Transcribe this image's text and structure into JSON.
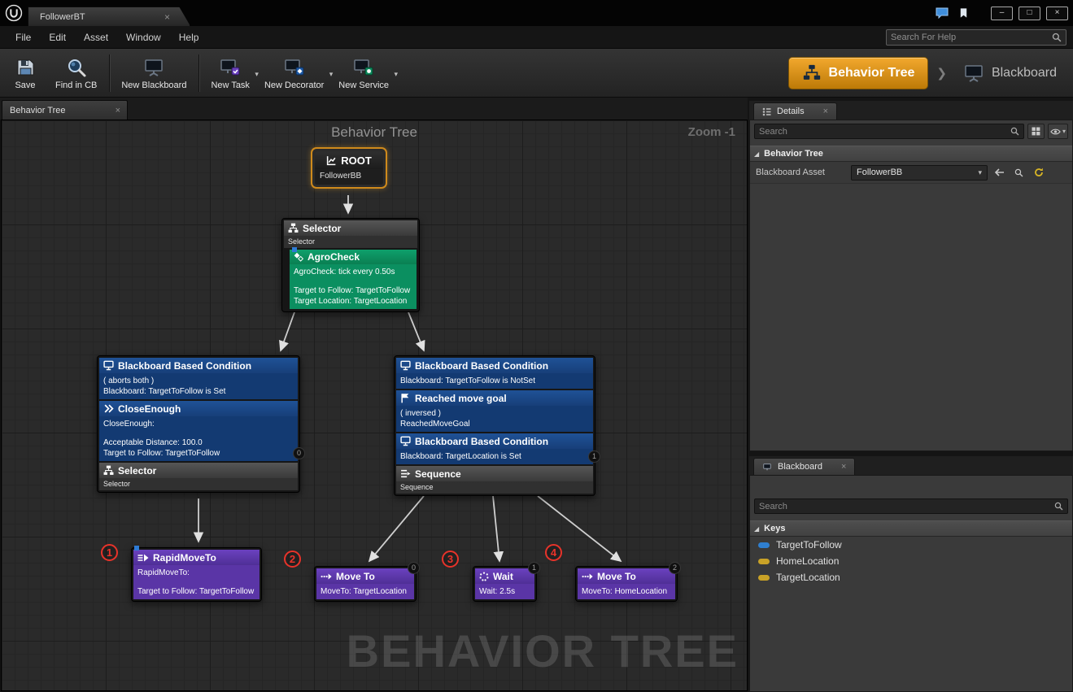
{
  "icons": {
    "close": "×",
    "dropdown": "▾",
    "chevron": "❯",
    "tri": "◢",
    "minimize": "–",
    "maximize": "□",
    "window_close": "×"
  },
  "titlebar": {
    "doc_tab": "FollowerBT"
  },
  "menubar": {
    "items": [
      "File",
      "Edit",
      "Asset",
      "Window",
      "Help"
    ],
    "help_search_placeholder": "Search For Help"
  },
  "toolbar": {
    "save": "Save",
    "find_in_cb": "Find in CB",
    "new_blackboard": "New Blackboard",
    "new_task": "New Task",
    "new_decorator": "New Decorator",
    "new_service": "New Service",
    "mode_behavior_tree": "Behavior Tree",
    "mode_blackboard": "Blackboard"
  },
  "doc_tab": "Behavior Tree",
  "graph": {
    "title": "Behavior Tree",
    "zoom": "Zoom -1",
    "watermark": "BEHAVIOR TREE",
    "root": {
      "title": "ROOT",
      "subtitle": "FollowerBB"
    },
    "selector": {
      "title": "Selector",
      "subtitle": "Selector"
    },
    "agrocheck": {
      "title": "AgroCheck",
      "line1": "AgroCheck: tick every 0.50s",
      "line2": "Target to Follow: TargetToFollow",
      "line3": "Target Location: TargetLocation"
    },
    "left": {
      "bbc_title": "Blackboard Based Condition",
      "bbc_line1": "( aborts both )",
      "bbc_line2": "Blackboard: TargetToFollow is Set",
      "ce_title": "CloseEnough",
      "ce_line1": "CloseEnough:",
      "ce_line2": "Acceptable Distance: 100.0",
      "ce_line3": "Target to Follow: TargetToFollow",
      "comp_title": "Selector",
      "comp_sub": "Selector",
      "badge": "0"
    },
    "right": {
      "bbc1_title": "Blackboard Based Condition",
      "bbc1_line1": "Blackboard: TargetToFollow is NotSet",
      "rmg_title": "Reached move goal",
      "rmg_line1": "( inversed )",
      "rmg_line2": "ReachedMoveGoal",
      "bbc2_title": "Blackboard Based Condition",
      "bbc2_line1": "Blackboard: TargetLocation is Set",
      "comp_title": "Sequence",
      "comp_sub": "Sequence",
      "badge": "1"
    },
    "task1": {
      "marker": "1",
      "title": "RapidMoveTo",
      "line1": "RapidMoveTo:",
      "line2": "Target to Follow: TargetToFollow"
    },
    "task2": {
      "marker": "2",
      "title": "Move To",
      "line1": "MoveTo: TargetLocation",
      "badge": "0"
    },
    "task3": {
      "marker": "3",
      "title": "Wait",
      "line1": "Wait: 2.5s",
      "badge": "1"
    },
    "task4": {
      "marker": "4",
      "title": "Move To",
      "line1": "MoveTo: HomeLocation",
      "badge": "2"
    }
  },
  "details": {
    "tab": "Details",
    "search_placeholder": "Search",
    "section": "Behavior Tree",
    "row_label": "Blackboard Asset",
    "row_value": "FollowerBB"
  },
  "blackboard": {
    "tab": "Blackboard",
    "search_placeholder": "Search",
    "keys_header": "Keys",
    "keys": [
      {
        "name": "TargetToFollow",
        "color": "#2f7fd0"
      },
      {
        "name": "HomeLocation",
        "color": "#c9a227"
      },
      {
        "name": "TargetLocation",
        "color": "#c9a227"
      }
    ]
  },
  "colors": {
    "accent_orange": "#d98e19",
    "decorator_blue": "#133a72",
    "service_green": "#0b8f60",
    "task_purple": "#5a35a6",
    "marker_red": "#e8332a"
  }
}
